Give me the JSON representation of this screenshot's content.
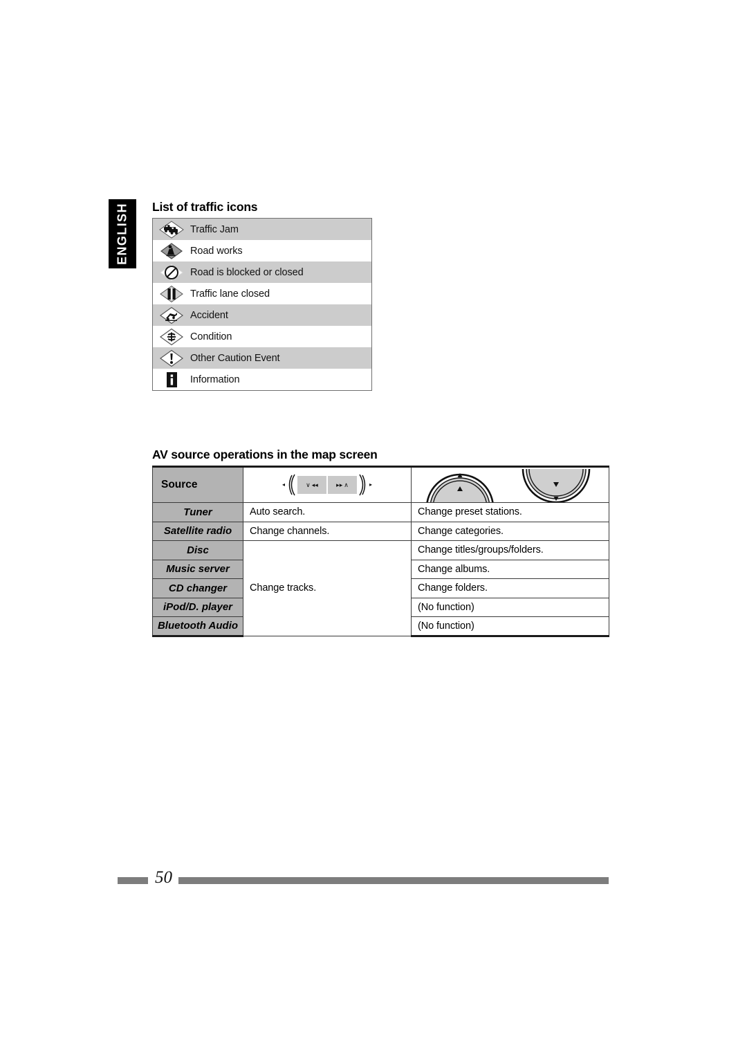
{
  "language_tab": {
    "label": "ENGLISH"
  },
  "traffic_section": {
    "heading": "List of traffic icons",
    "rows": [
      {
        "icon": "traffic-jam-icon",
        "label": "Traffic Jam",
        "shaded": true
      },
      {
        "icon": "road-works-icon",
        "label": "Road works",
        "shaded": false
      },
      {
        "icon": "road-blocked-icon",
        "label": "Road is blocked or closed",
        "shaded": true
      },
      {
        "icon": "lane-closed-icon",
        "label": "Traffic lane closed",
        "shaded": false
      },
      {
        "icon": "accident-icon",
        "label": "Accident",
        "shaded": true
      },
      {
        "icon": "condition-icon",
        "label": "Condition",
        "shaded": false
      },
      {
        "icon": "other-caution-event-icon",
        "label": "Other Caution Event",
        "shaded": true
      },
      {
        "icon": "information-icon",
        "label": "Information",
        "shaded": false
      }
    ]
  },
  "av_section": {
    "heading": "AV source operations in the map screen",
    "header": {
      "source_label": "Source",
      "seek_icon": "seek-track-buttons-icon",
      "dial_icon": "up-down-dial-buttons-icon"
    },
    "rows": [
      {
        "source": "Tuner",
        "seek": "Auto search.",
        "dial": "Change preset stations."
      },
      {
        "source": "Satellite radio",
        "seek": "Change channels.",
        "dial": "Change categories."
      },
      {
        "source": "Disc",
        "seek": "",
        "dial": "Change titles/groups/folders."
      },
      {
        "source": "Music server",
        "seek": "",
        "dial": "Change albums."
      },
      {
        "source": "CD changer",
        "seek": "Change tracks.",
        "dial": "Change folders."
      },
      {
        "source": "iPod/D. player",
        "seek": "",
        "dial": "(No function)"
      },
      {
        "source": "Bluetooth Audio",
        "seek": "",
        "dial": "(No function)"
      }
    ],
    "merged_seek_label": "Change tracks."
  },
  "footer": {
    "page_number": "50"
  },
  "colors": {
    "shaded_row": "#cccccc",
    "source_column": "#b3b3b3",
    "tab_background": "#000000",
    "tab_text": "#ffffff",
    "footer_bar": "#7d7d7d",
    "table_border": "#3a3a3a"
  }
}
